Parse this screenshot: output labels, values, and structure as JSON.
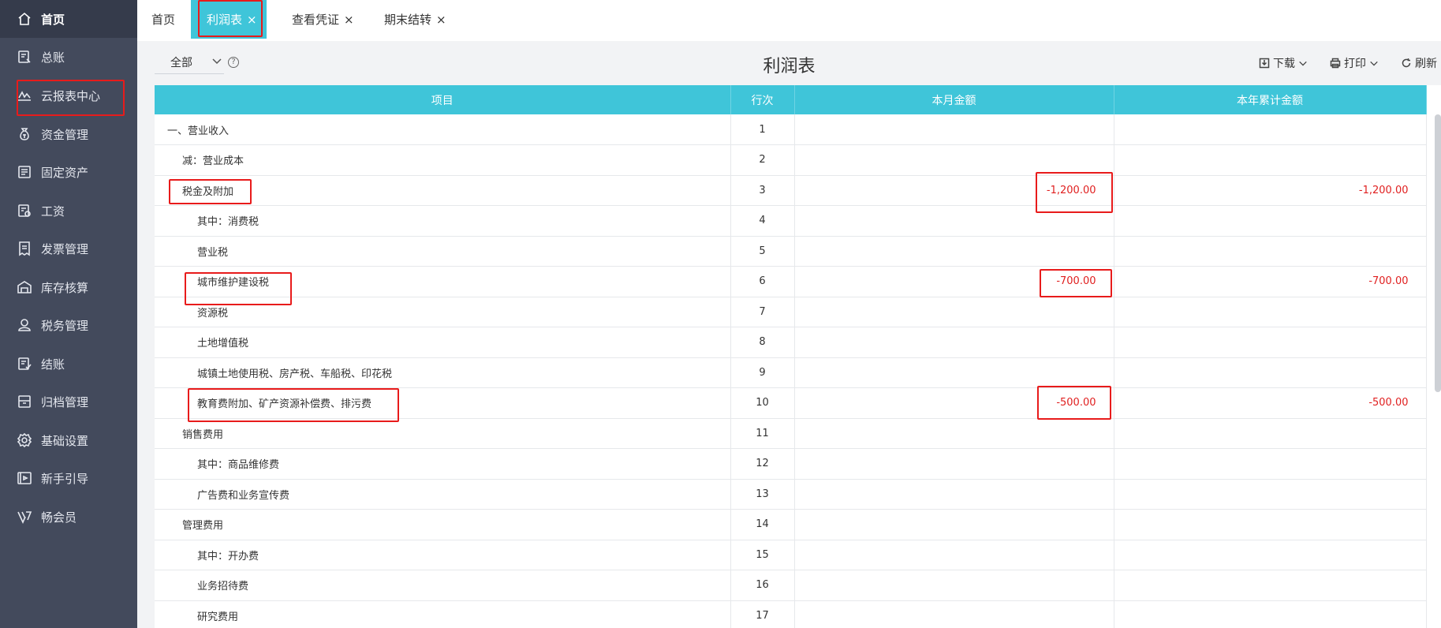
{
  "sidebar": {
    "items": [
      {
        "label": "首页",
        "icon": "home-icon",
        "active": true
      },
      {
        "label": "总账",
        "icon": "ledger-icon"
      },
      {
        "label": "云报表中心",
        "icon": "chart-icon"
      },
      {
        "label": "资金管理",
        "icon": "money-bag-icon"
      },
      {
        "label": "固定资产",
        "icon": "asset-icon"
      },
      {
        "label": "工资",
        "icon": "salary-icon"
      },
      {
        "label": "发票管理",
        "icon": "invoice-icon"
      },
      {
        "label": "库存核算",
        "icon": "warehouse-icon"
      },
      {
        "label": "税务管理",
        "icon": "tax-icon"
      },
      {
        "label": "结账",
        "icon": "checkout-icon"
      },
      {
        "label": "归档管理",
        "icon": "archive-icon"
      },
      {
        "label": "基础设置",
        "icon": "gear-icon"
      },
      {
        "label": "新手引导",
        "icon": "guide-icon"
      },
      {
        "label": "畅会员",
        "icon": "vip-icon"
      }
    ]
  },
  "tabs": [
    {
      "label": "首页",
      "closable": false
    },
    {
      "label": "利润表",
      "closable": true,
      "active": true
    },
    {
      "label": "查看凭证",
      "closable": true
    },
    {
      "label": "期末结转",
      "closable": true
    }
  ],
  "toolbar": {
    "scope_select": "全部",
    "title": "利润表",
    "download_label": "下载",
    "print_label": "打印",
    "refresh_label": "刷新"
  },
  "table": {
    "headers": [
      "项目",
      "行次",
      "本月金额",
      "本年累计金额"
    ],
    "rows": [
      {
        "item": "一、营业收入",
        "indent": 0,
        "line": "1",
        "month": "",
        "year": ""
      },
      {
        "item": "减：营业成本",
        "indent": 1,
        "line": "2",
        "month": "",
        "year": ""
      },
      {
        "item": "税金及附加",
        "indent": 1,
        "line": "3",
        "month": "-1,200.00",
        "year": "-1,200.00"
      },
      {
        "item": "其中：消费税",
        "indent": 2,
        "line": "4",
        "month": "",
        "year": ""
      },
      {
        "item": "营业税",
        "indent": 2,
        "line": "5",
        "month": "",
        "year": ""
      },
      {
        "item": "城市维护建设税",
        "indent": 2,
        "line": "6",
        "month": "-700.00",
        "year": "-700.00"
      },
      {
        "item": "资源税",
        "indent": 2,
        "line": "7",
        "month": "",
        "year": ""
      },
      {
        "item": "土地增值税",
        "indent": 2,
        "line": "8",
        "month": "",
        "year": ""
      },
      {
        "item": "城镇土地使用税、房产税、车船税、印花税",
        "indent": 2,
        "line": "9",
        "month": "",
        "year": ""
      },
      {
        "item": "教育费附加、矿产资源补偿费、排污费",
        "indent": 2,
        "line": "10",
        "month": "-500.00",
        "year": "-500.00"
      },
      {
        "item": "销售费用",
        "indent": 1,
        "line": "11",
        "month": "",
        "year": ""
      },
      {
        "item": "其中：商品维修费",
        "indent": 2,
        "line": "12",
        "month": "",
        "year": ""
      },
      {
        "item": "广告费和业务宣传费",
        "indent": 2,
        "line": "13",
        "month": "",
        "year": ""
      },
      {
        "item": "管理费用",
        "indent": 1,
        "line": "14",
        "month": "",
        "year": ""
      },
      {
        "item": "其中：开办费",
        "indent": 2,
        "line": "15",
        "month": "",
        "year": ""
      },
      {
        "item": "业务招待费",
        "indent": 2,
        "line": "16",
        "month": "",
        "year": ""
      },
      {
        "item": "研究费用",
        "indent": 2,
        "line": "17",
        "month": "",
        "year": ""
      }
    ]
  },
  "colors": {
    "sidebar_bg": "#434a5c",
    "accent": "#3fc5d9",
    "negative": "#e02020",
    "highlight": "#e81b1b"
  }
}
